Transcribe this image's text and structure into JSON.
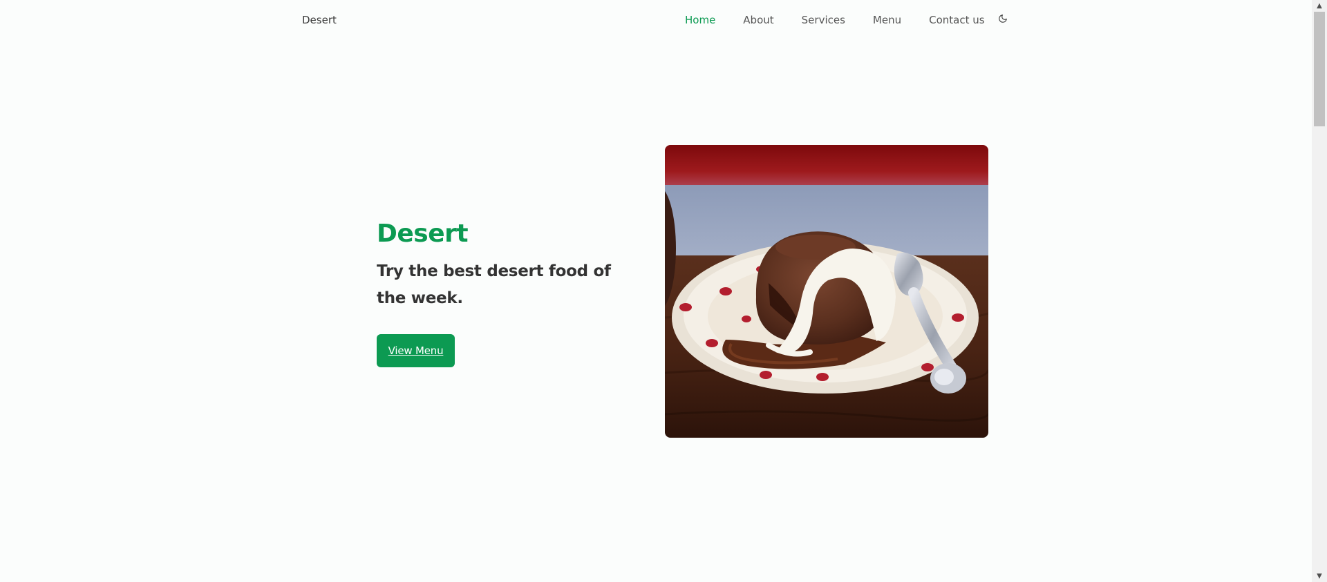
{
  "header": {
    "logo": "Desert",
    "nav": [
      {
        "label": "Home",
        "active": true
      },
      {
        "label": "About",
        "active": false
      },
      {
        "label": "Services",
        "active": false
      },
      {
        "label": "Menu",
        "active": false
      },
      {
        "label": "Contact us",
        "active": false
      }
    ],
    "theme_icon": "moon-icon"
  },
  "hero": {
    "title": "Desert",
    "description": "Try the best desert food of the week.",
    "button_label": "View Menu",
    "image_alt": "chocolate lava cake with cream on a polka-dot plate with a spoon"
  },
  "colors": {
    "accent": "#0c9a52",
    "text_dark": "#333333",
    "nav_text": "#555555",
    "background": "#fbfdfc"
  }
}
